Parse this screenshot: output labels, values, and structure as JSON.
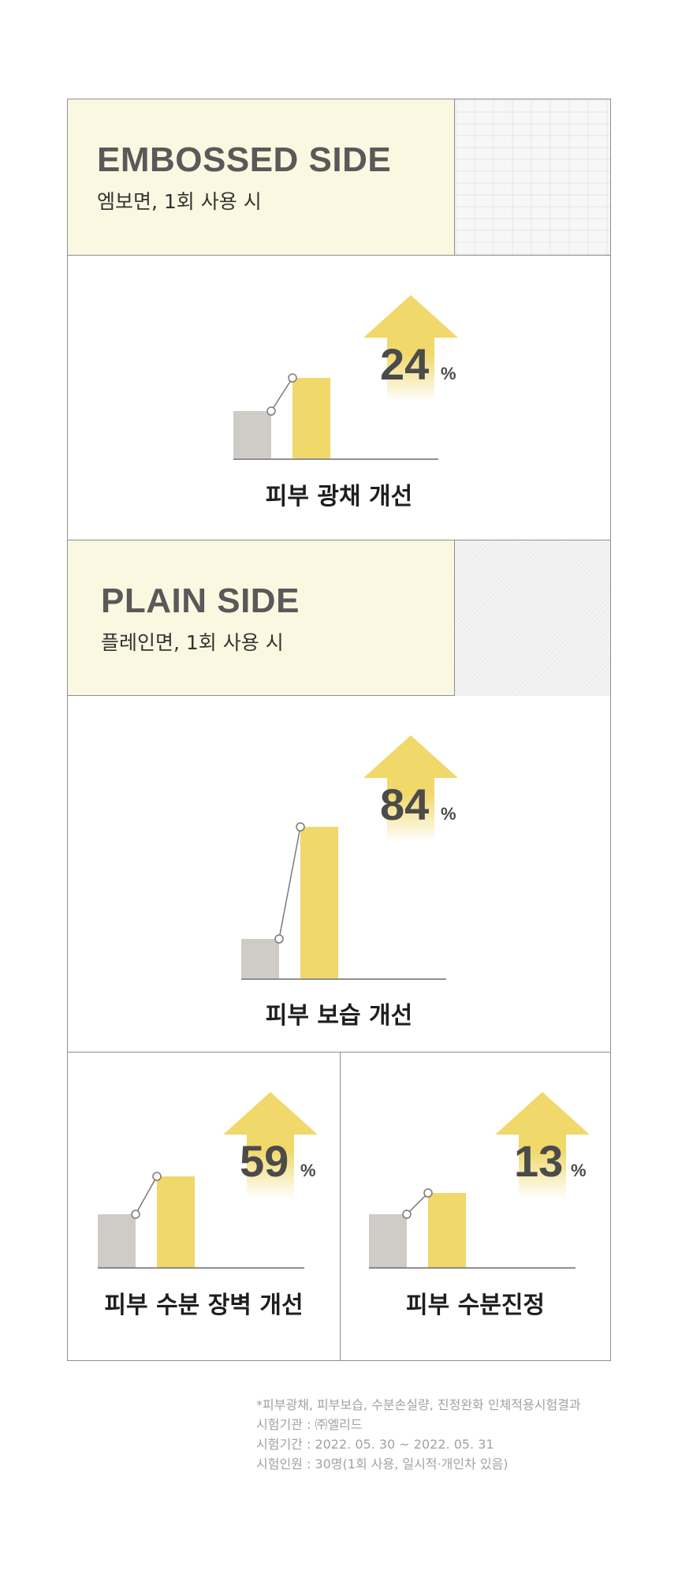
{
  "sections": [
    {
      "title": "EMBOSSED SIDE",
      "subtitle": "엠보면, 1회 사용 시",
      "swatch": "embossed-texture"
    },
    {
      "title": "PLAIN SIDE",
      "subtitle": "플레인면, 1회 사용 시",
      "swatch": "plain-texture"
    }
  ],
  "colors": {
    "before_bar": "#cfccc7",
    "after_bar": "#f0d86a",
    "arrow": "#f0d86a",
    "header_bg": "#faf8e1"
  },
  "chart_data": [
    {
      "type": "bar",
      "title": "피부 광채 개선",
      "categories": [
        "before",
        "after"
      ],
      "improvement": "24",
      "unit": "%"
    },
    {
      "type": "bar",
      "title": "피부 보습 개선",
      "categories": [
        "before",
        "after"
      ],
      "improvement": "84",
      "unit": "%"
    },
    {
      "type": "bar",
      "title": "피부 수분 장벽 개선",
      "categories": [
        "before",
        "after"
      ],
      "improvement": "59",
      "unit": "%"
    },
    {
      "type": "bar",
      "title": "피부 수분진정",
      "categories": [
        "before",
        "after"
      ],
      "improvement": "13",
      "unit": "%"
    }
  ],
  "notes": [
    "*피부광채, 피부보습, 수분손실량, 진정완화 인체적용시험결과",
    "시험기관 : ㈜엘리드",
    "시험기간 : 2022. 05. 30 ~ 2022. 05. 31",
    "시험인원 : 30명(1회 사용, 일시적·개인차 있음)"
  ]
}
